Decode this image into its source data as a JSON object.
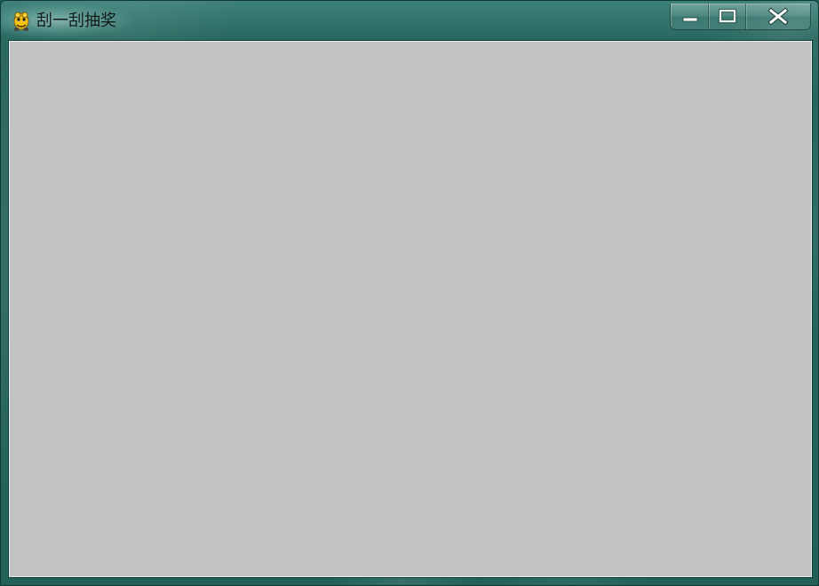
{
  "window": {
    "title": "刮一刮抽奖",
    "app_icon": "pygame-snake-icon",
    "client_background": "#c2c2c2",
    "frame_color": "#2b6b63"
  },
  "caption_buttons": {
    "minimize_icon": "minimize-icon",
    "maximize_icon": "maximize-icon",
    "close_icon": "close-icon"
  }
}
